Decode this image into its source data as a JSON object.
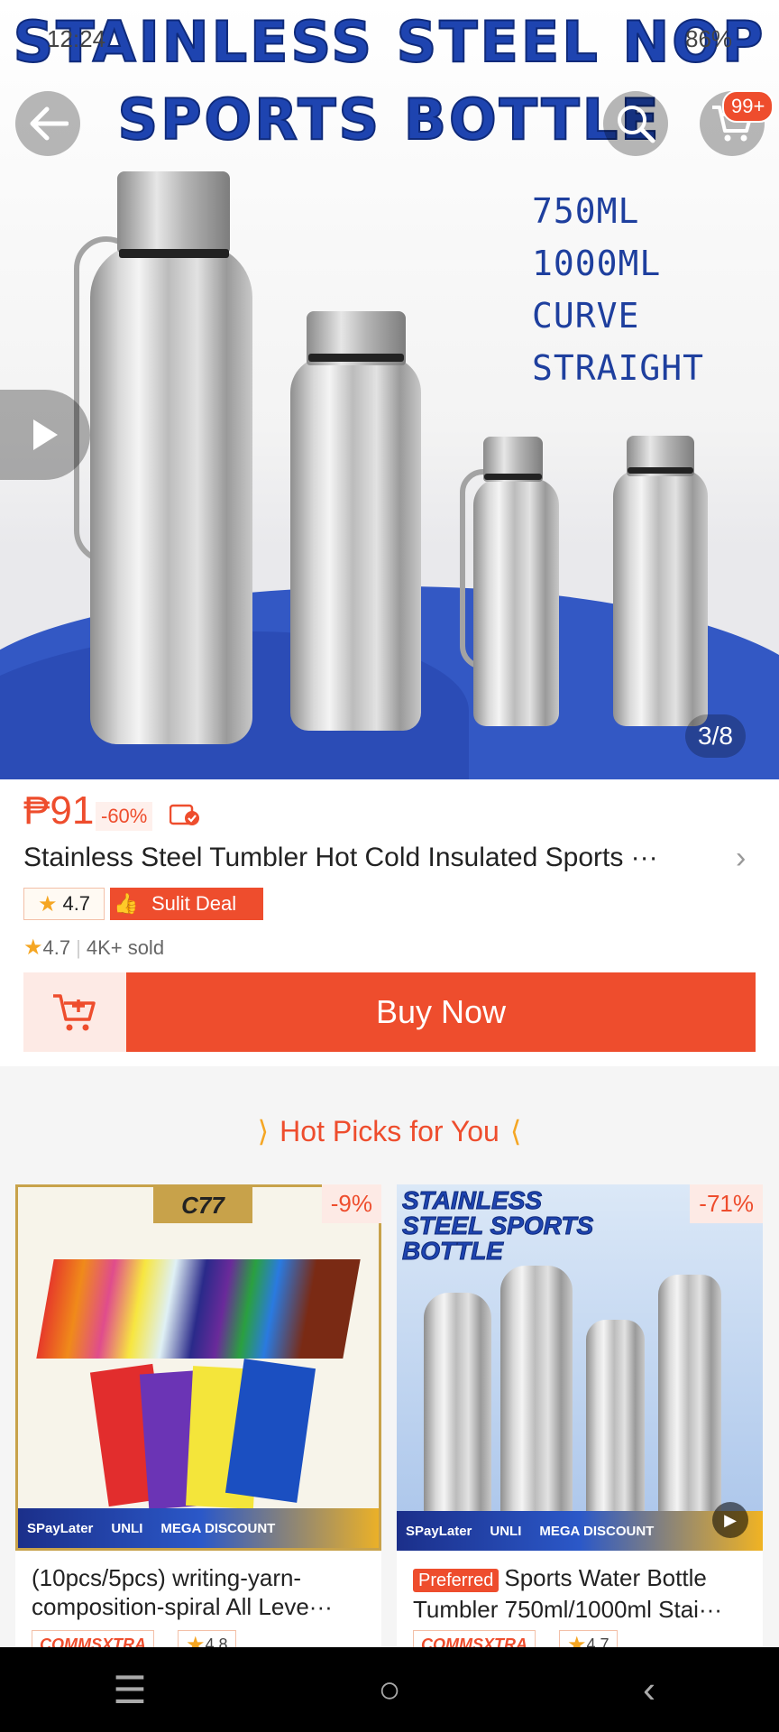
{
  "status_bar": {
    "time": "12:24",
    "battery": "86%"
  },
  "hero": {
    "title_line1": "STAINLESS STEEL NOP",
    "title_line2": "SPORTS BOTTLE",
    "sizes": [
      "750ML",
      "1000ML",
      "CURVE",
      "STRAIGHT"
    ],
    "image_counter": "3/8",
    "cart_badge": "99+"
  },
  "product": {
    "price": "₱91",
    "discount": "-60%",
    "title": "Stainless Steel Tumbler Hot Cold Insulated Sports ···",
    "rating": "4.7",
    "deal_label": "Sulit Deal",
    "sold_rating": "4.7",
    "sold": "4K+ sold",
    "buy_label": "Buy Now"
  },
  "hot_picks": {
    "title": "Hot Picks for You",
    "items": [
      {
        "discount": "-9%",
        "title": "(10pcs/5pcs)  writing-yarn-composition-spiral All Leve···",
        "shop_tag": "COMMSXTRA",
        "rating": "4.8",
        "preferred": "",
        "shop": "C77",
        "promo": [
          "SPayLater",
          "UNLI",
          "MEGA DISCOUNT"
        ]
      },
      {
        "discount": "-71%",
        "title": "Sports Water Bottle Tumbler 750ml/1000ml Stai···",
        "shop_tag": "COMMSXTRA",
        "rating": "4.7",
        "preferred": "Preferred",
        "banner": "STAINLESS STEEL SPORTS BOTTLE",
        "promo": [
          "SPayLater",
          "UNLI",
          "MEGA DISCOUNT"
        ]
      }
    ]
  },
  "colors": {
    "accent": "#ee4d2d",
    "hero_blue": "#1e44b0",
    "star": "#f5a623"
  }
}
